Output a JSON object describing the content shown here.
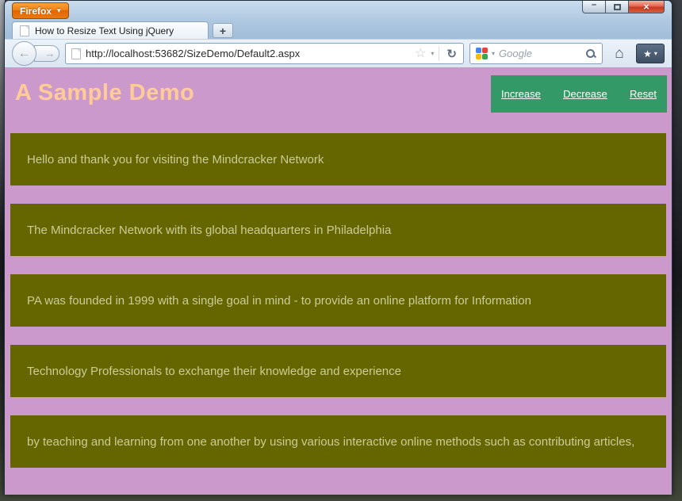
{
  "chrome": {
    "firefox_button_label": "Firefox",
    "tab_title": "How to Resize Text Using jQuery",
    "url": "http://localhost:53682/SizeDemo/Default2.aspx",
    "search_placeholder": "Google"
  },
  "icons": {
    "caret": "▾",
    "plus": "+",
    "back_arrow": "←",
    "forward_arrow": "→",
    "star": "☆",
    "reload": "↻",
    "home": "⌂",
    "bookmarks_star": "★",
    "minimize": "–",
    "close": "×"
  },
  "page": {
    "title": "A Sample Demo",
    "links": [
      "Increase",
      "Decrease",
      "Reset"
    ],
    "bars": [
      "Hello and thank you for visiting the Mindcracker Network",
      "The Mindcracker Network with its global headquarters in Philadelphia",
      "PA was founded in 1999 with a single goal in mind - to provide an online platform for Information",
      "Technology Professionals to exchange their knowledge and experience",
      "by teaching and learning from one another by using various interactive online methods such as contributing articles,"
    ],
    "colors": {
      "background": "#CC99CC",
      "bar_background": "#666600",
      "bar_text": "#CCCC99",
      "title_text": "#FFCC99",
      "toolbar_background": "#339966",
      "link_text": "#FFFFFF"
    }
  }
}
